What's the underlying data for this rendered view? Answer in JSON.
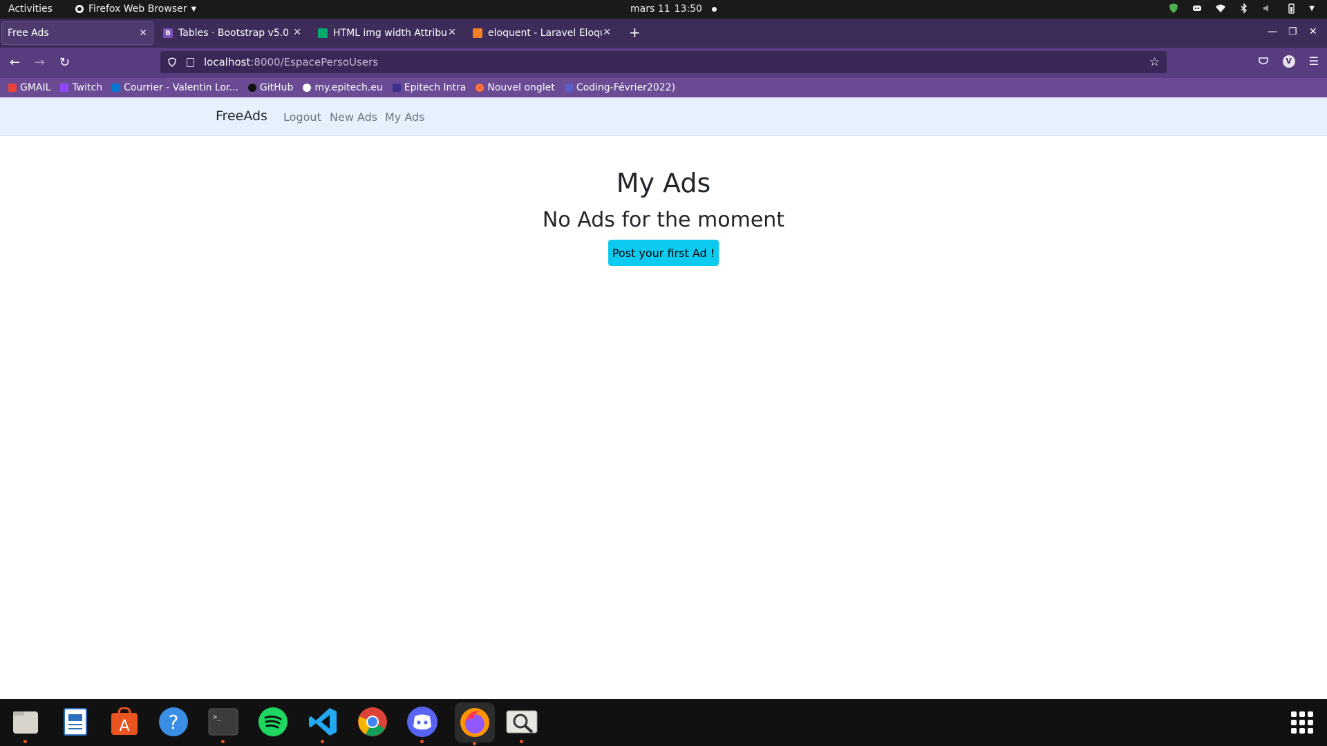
{
  "system_bar": {
    "activities": "Activities",
    "app_name": "Firefox Web Browser",
    "date": "mars 11",
    "time": "13:50"
  },
  "browser": {
    "tabs": [
      {
        "title": "Free Ads",
        "active": true
      },
      {
        "title": "Tables · Bootstrap v5.0",
        "active": false
      },
      {
        "title": "HTML img width Attribut",
        "active": false
      },
      {
        "title": "eloquent - Laravel Éloque",
        "active": false
      }
    ],
    "url": {
      "host": "localhost",
      "path": ":8000/EspacePersoUsers"
    },
    "profile_initial": "V",
    "bookmarks": [
      "GMAIL",
      "Twitch",
      "Courrier - Valentin Lor...",
      "GitHub",
      "my.epitech.eu",
      "Epitech Intra",
      "Nouvel onglet",
      "Coding-Février2022)"
    ]
  },
  "site": {
    "brand": "FreeAds",
    "nav": [
      "Logout",
      "New Ads",
      "My Ads"
    ],
    "heading": "My Ads",
    "subheading": "No Ads for the moment",
    "cta_label": "Post your first Ad !",
    "colors": {
      "navbar_bg": "#e7f1fd",
      "cta": "#0dcaf0"
    }
  },
  "dock": {
    "apps": [
      "files-icon",
      "text-editor-icon",
      "software-center-icon",
      "help-icon",
      "terminal-icon",
      "spotify-icon",
      "vscode-icon",
      "chrome-icon",
      "discord-icon",
      "firefox-icon",
      "image-viewer-icon"
    ]
  }
}
